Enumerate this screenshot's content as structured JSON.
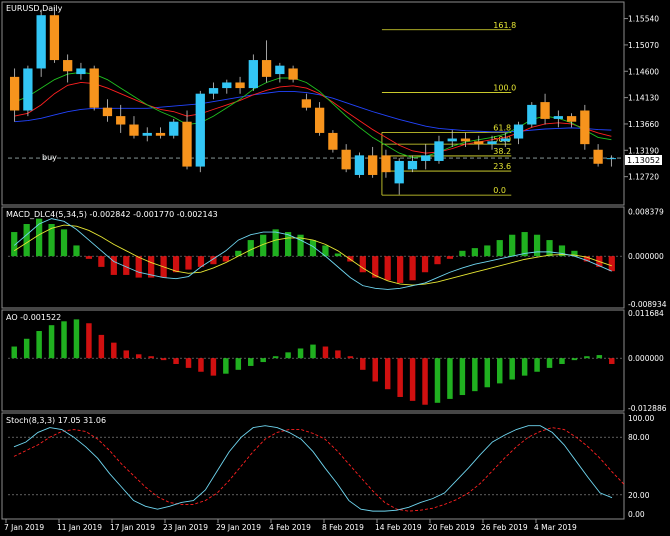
{
  "window_title": "EURUSD,Daily",
  "colors": {
    "background": "#000000",
    "grid": "#1f1f1f",
    "frame": "#8c8c8c",
    "bull": "#33c6f5",
    "bear": "#f7941d",
    "fib": "#e6e633",
    "ma_red": "#ff2020",
    "ma_blue": "#2244ff",
    "ma_green": "#20c020",
    "macd_line": "#6fd6f0",
    "signal_line": "#e6e633",
    "hist_green": "#20b020",
    "hist_red": "#d01010",
    "stoch_main": "#6fd6f0",
    "stoch_signal": "#ff2020",
    "price_label_bg": "#ffffff"
  },
  "main_panel": {
    "buy_label": "buy",
    "current_price": "1.13052",
    "price_ticks": [
      "1.15540",
      "1.15070",
      "1.14600",
      "1.14130",
      "1.13660",
      "1.13190",
      "1.12720"
    ],
    "fib_levels": [
      {
        "label": "161.8",
        "price": 1.1534
      },
      {
        "label": "100.0",
        "price": 1.1422
      },
      {
        "label": "61.8",
        "price": 1.1351
      },
      {
        "label": "50.0",
        "price": 1.133
      },
      {
        "label": "38.2",
        "price": 1.1309
      },
      {
        "label": "23.6",
        "price": 1.1282
      },
      {
        "label": "0.0",
        "price": 1.1239
      }
    ],
    "candles": [
      [
        1.145,
        1.1465,
        1.137,
        1.139
      ],
      [
        1.139,
        1.147,
        1.138,
        1.1465
      ],
      [
        1.1465,
        1.157,
        1.145,
        1.156
      ],
      [
        1.156,
        1.1575,
        1.1475,
        1.148
      ],
      [
        1.148,
        1.149,
        1.144,
        1.146
      ],
      [
        1.1455,
        1.1475,
        1.1445,
        1.1465
      ],
      [
        1.1465,
        1.147,
        1.139,
        1.1395
      ],
      [
        1.1395,
        1.141,
        1.137,
        1.138
      ],
      [
        1.138,
        1.14,
        1.135,
        1.1365
      ],
      [
        1.1365,
        1.138,
        1.134,
        1.1345
      ],
      [
        1.1345,
        1.136,
        1.1335,
        1.135
      ],
      [
        1.135,
        1.136,
        1.134,
        1.1345
      ],
      [
        1.1345,
        1.1375,
        1.134,
        1.137
      ],
      [
        1.137,
        1.139,
        1.1285,
        1.129
      ],
      [
        1.129,
        1.1425,
        1.128,
        1.142
      ],
      [
        1.142,
        1.144,
        1.141,
        1.143
      ],
      [
        1.143,
        1.1445,
        1.142,
        1.144
      ],
      [
        1.144,
        1.145,
        1.142,
        1.143
      ],
      [
        1.143,
        1.149,
        1.1425,
        1.148
      ],
      [
        1.148,
        1.1515,
        1.144,
        1.145
      ],
      [
        1.1455,
        1.1475,
        1.144,
        1.147
      ],
      [
        1.1465,
        1.147,
        1.144,
        1.1445
      ],
      [
        1.141,
        1.142,
        1.139,
        1.1395
      ],
      [
        1.1395,
        1.1405,
        1.1345,
        1.135
      ],
      [
        1.135,
        1.1355,
        1.1315,
        1.132
      ],
      [
        1.132,
        1.133,
        1.128,
        1.1285
      ],
      [
        1.1275,
        1.1315,
        1.127,
        1.131
      ],
      [
        1.131,
        1.1325,
        1.127,
        1.1275
      ],
      [
        1.131,
        1.132,
        1.127,
        1.128
      ],
      [
        1.126,
        1.1305,
        1.124,
        1.13
      ],
      [
        1.1285,
        1.131,
        1.128,
        1.13
      ],
      [
        1.13,
        1.133,
        1.1285,
        1.131
      ],
      [
        1.13,
        1.1345,
        1.1295,
        1.1335
      ],
      [
        1.1335,
        1.1355,
        1.1325,
        1.134
      ],
      [
        1.134,
        1.135,
        1.1325,
        1.1335
      ],
      [
        1.1335,
        1.1345,
        1.132,
        1.133
      ],
      [
        1.133,
        1.1345,
        1.132,
        1.1335
      ],
      [
        1.1335,
        1.135,
        1.1325,
        1.134
      ],
      [
        1.134,
        1.137,
        1.133,
        1.1365
      ],
      [
        1.1365,
        1.1405,
        1.136,
        1.14
      ],
      [
        1.1405,
        1.142,
        1.1365,
        1.1375
      ],
      [
        1.1375,
        1.139,
        1.136,
        1.138
      ],
      [
        1.138,
        1.1385,
        1.136,
        1.137
      ],
      [
        1.139,
        1.14,
        1.132,
        1.133
      ],
      [
        1.132,
        1.133,
        1.129,
        1.1295
      ],
      [
        1.1305,
        1.131,
        1.129,
        1.1305
      ]
    ],
    "ma_red": [
      1.138,
      1.1385,
      1.14,
      1.142,
      1.1435,
      1.144,
      1.1438,
      1.143,
      1.142,
      1.141,
      1.14,
      1.1392,
      1.1388,
      1.138,
      1.1384,
      1.1392,
      1.14,
      1.1408,
      1.1418,
      1.1426,
      1.1432,
      1.1434,
      1.143,
      1.142,
      1.1405,
      1.1388,
      1.1372,
      1.1356,
      1.1342,
      1.1328,
      1.1318,
      1.1314,
      1.1316,
      1.1322,
      1.133,
      1.1334,
      1.1338,
      1.1342,
      1.135,
      1.136,
      1.1366,
      1.1368,
      1.1366,
      1.1358,
      1.135,
      1.1344
    ],
    "ma_blue": [
      1.137,
      1.1372,
      1.1376,
      1.1382,
      1.1388,
      1.1392,
      1.1394,
      1.1394,
      1.1394,
      1.1394,
      1.1394,
      1.1396,
      1.1398,
      1.14,
      1.1402,
      1.1406,
      1.141,
      1.1414,
      1.1418,
      1.1421,
      1.1424,
      1.1424,
      1.1422,
      1.1418,
      1.1412,
      1.1404,
      1.1396,
      1.1388,
      1.1381,
      1.1374,
      1.1368,
      1.1362,
      1.1358,
      1.1356,
      1.1354,
      1.1353,
      1.1352,
      1.1352,
      1.1353,
      1.1355,
      1.1357,
      1.1358,
      1.1359,
      1.1358,
      1.1356,
      1.1355
    ],
    "ma_green": [
      1.1405,
      1.1415,
      1.143,
      1.1445,
      1.1455,
      1.1458,
      1.1455,
      1.1445,
      1.143,
      1.1415,
      1.14,
      1.1388,
      1.1378,
      1.1365,
      1.1368,
      1.138,
      1.1395,
      1.141,
      1.1428,
      1.144,
      1.1448,
      1.1448,
      1.144,
      1.1424,
      1.1402,
      1.138,
      1.136,
      1.1342,
      1.1328,
      1.1314,
      1.1306,
      1.1308,
      1.1316,
      1.1326,
      1.1334,
      1.1338,
      1.1342,
      1.1348,
      1.136,
      1.1374,
      1.138,
      1.1376,
      1.1368,
      1.1355,
      1.1342,
      1.1338
    ]
  },
  "macd_panel": {
    "label": "MACD_DLC4(5,34,5) -0.002842 -0.001770 -0.002143",
    "ticks": [
      "0.008379",
      "0.000000",
      "-0.008934"
    ],
    "hist": [
      0.0045,
      0.006,
      0.007,
      0.006,
      0.005,
      0.002,
      -0.0005,
      -0.002,
      -0.0035,
      -0.0035,
      -0.004,
      -0.004,
      -0.004,
      -0.003,
      -0.0025,
      -0.002,
      -0.0015,
      -0.001,
      0.001,
      0.003,
      0.004,
      0.005,
      0.0045,
      0.004,
      0.003,
      0.002,
      0.0005,
      -0.001,
      -0.003,
      -0.004,
      -0.0045,
      -0.005,
      -0.0045,
      -0.003,
      -0.0015,
      -0.0005,
      0.001,
      0.0015,
      0.002,
      0.003,
      0.004,
      0.0045,
      0.004,
      0.003,
      0.002,
      0.001,
      -0.001,
      -0.002,
      -0.0028
    ],
    "macd": [
      0.002,
      0.004,
      0.006,
      0.007,
      0.0065,
      0.005,
      0.003,
      0.001,
      -0.001,
      -0.002,
      -0.003,
      -0.0035,
      -0.004,
      -0.0042,
      -0.0038,
      -0.002,
      -0.0005,
      0.001,
      0.003,
      0.004,
      0.0045,
      0.0045,
      0.004,
      0.003,
      0.0018,
      0.0,
      -0.002,
      -0.004,
      -0.0055,
      -0.006,
      -0.0062,
      -0.006,
      -0.0055,
      -0.005,
      -0.004,
      -0.003,
      -0.0022,
      -0.0015,
      -0.001,
      -0.0005,
      0.0,
      0.0005,
      0.0008,
      0.0008,
      0.0005,
      0.0,
      -0.0008,
      -0.0018,
      -0.0028
    ],
    "signal": [
      0.001,
      0.0025,
      0.004,
      0.0052,
      0.0058,
      0.0056,
      0.0048,
      0.0036,
      0.0022,
      0.001,
      -0.0002,
      -0.0012,
      -0.002,
      -0.0028,
      -0.0032,
      -0.003,
      -0.0022,
      -0.0012,
      0.0,
      0.0012,
      0.0022,
      0.003,
      0.0034,
      0.0034,
      0.003,
      0.0022,
      0.001,
      -0.0006,
      -0.0022,
      -0.0036,
      -0.0046,
      -0.0052,
      -0.0054,
      -0.0052,
      -0.0048,
      -0.0042,
      -0.0036,
      -0.003,
      -0.0024,
      -0.0018,
      -0.0012,
      -0.0006,
      -0.0002,
      0.0002,
      0.0003,
      0.0002,
      -0.0002,
      -0.001,
      -0.0018
    ]
  },
  "ao_panel": {
    "label": "AO -0.001522",
    "ticks": [
      "0.011684",
      "0.000000",
      "-0.012886"
    ],
    "hist": [
      0.003,
      0.005,
      0.007,
      0.0085,
      0.0095,
      0.01,
      0.009,
      0.006,
      0.004,
      0.002,
      0.001,
      0.0005,
      -0.0005,
      -0.0015,
      -0.0025,
      -0.0035,
      -0.0045,
      -0.004,
      -0.003,
      -0.002,
      -0.001,
      0.0005,
      0.0015,
      0.0025,
      0.0035,
      0.003,
      0.002,
      0.0005,
      -0.003,
      -0.006,
      -0.008,
      -0.01,
      -0.011,
      -0.012,
      -0.0115,
      -0.0105,
      -0.0095,
      -0.0085,
      -0.0075,
      -0.0065,
      -0.0055,
      -0.0045,
      -0.0035,
      -0.0025,
      -0.0015,
      -0.0005,
      0.0005,
      0.0008,
      -0.0015
    ]
  },
  "stoch_panel": {
    "label": "Stoch(8,3,3) 17.05 31.06",
    "ticks": [
      "100.00",
      "80.00",
      "20.00",
      "0.00"
    ],
    "main": [
      70,
      75,
      85,
      90,
      88,
      80,
      70,
      58,
      42,
      28,
      14,
      8,
      5,
      8,
      12,
      14,
      25,
      45,
      65,
      80,
      90,
      92,
      90,
      85,
      78,
      65,
      48,
      32,
      14,
      5,
      3,
      3,
      4,
      7,
      12,
      16,
      22,
      35,
      48,
      62,
      75,
      82,
      88,
      92,
      92,
      85,
      72,
      55,
      38,
      22,
      17
    ],
    "signal": [
      60,
      66,
      72,
      80,
      86,
      88,
      86,
      78,
      66,
      52,
      40,
      28,
      18,
      12,
      10,
      10,
      14,
      22,
      35,
      50,
      65,
      78,
      85,
      88,
      88,
      84,
      78,
      66,
      52,
      38,
      24,
      12,
      5,
      3,
      4,
      6,
      10,
      15,
      22,
      32,
      45,
      58,
      70,
      80,
      86,
      90,
      88,
      80,
      70,
      58,
      44,
      31
    ]
  },
  "time_axis": [
    "7 Jan 2019",
    "11 Jan 2019",
    "17 Jan 2019",
    "23 Jan 2019",
    "29 Jan 2019",
    "4 Feb 2019",
    "8 Feb 2019",
    "14 Feb 2019",
    "20 Feb 2019",
    "26 Feb 2019",
    "4 Mar 2019"
  ]
}
